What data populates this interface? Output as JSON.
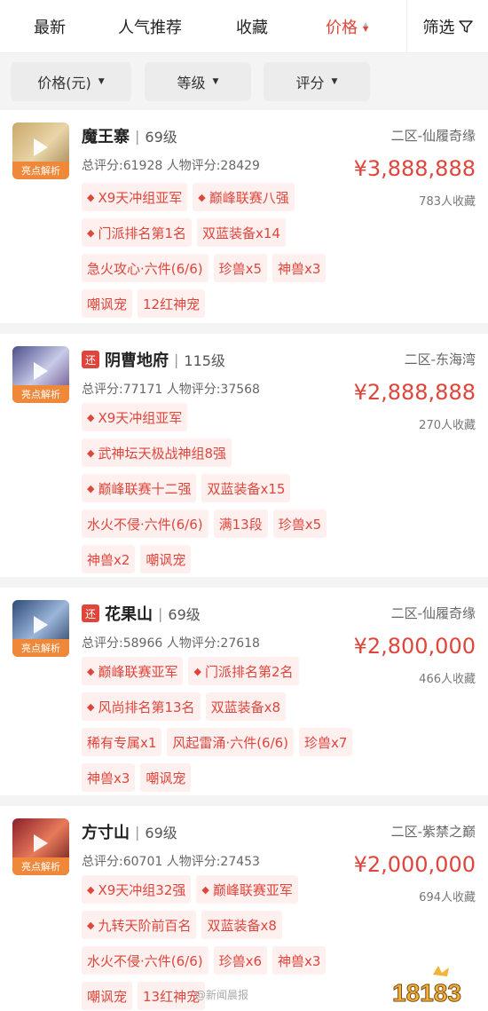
{
  "tabs": [
    {
      "label": "最新"
    },
    {
      "label": "人气推荐"
    },
    {
      "label": "收藏"
    },
    {
      "label": "价格"
    }
  ],
  "filter_label": "筛选",
  "filters": [
    {
      "label": "价格(元)"
    },
    {
      "label": "等级"
    },
    {
      "label": "评分"
    }
  ],
  "avatar_badge": "亮点解析",
  "items": [
    {
      "name": "魔王寨",
      "level": "69级",
      "huan": "",
      "server": "二区-仙履奇缘",
      "score": "总评分:61928 人物评分:28429",
      "price": "¥3,888,888",
      "favorites": "783人收藏",
      "tags": [
        {
          "text": "X9天冲组亚军",
          "diamond": true
        },
        {
          "text": "巅峰联赛八强",
          "diamond": true
        },
        {
          "text": "门派排名第1名",
          "diamond": true
        },
        {
          "text": "双蓝装备x14",
          "diamond": false
        },
        {
          "text": "急火攻心·六件(6/6)",
          "diamond": false
        },
        {
          "text": "珍兽x5",
          "diamond": false
        },
        {
          "text": "神兽x3",
          "diamond": false
        },
        {
          "text": "嘲讽宠",
          "diamond": false
        },
        {
          "text": "12红神宠",
          "diamond": false
        }
      ]
    },
    {
      "name": "阴曹地府",
      "level": "115级",
      "huan": "还",
      "server": "二区-东海湾",
      "score": "总评分:77171 人物评分:37568",
      "price": "¥2,888,888",
      "favorites": "270人收藏",
      "tags": [
        {
          "text": "X9天冲组亚军",
          "diamond": true
        },
        {
          "text": "武神坛天极战神组8强",
          "diamond": true
        },
        {
          "text": "巅峰联赛十二强",
          "diamond": true
        },
        {
          "text": "双蓝装备x15",
          "diamond": false
        },
        {
          "text": "水火不侵·六件(6/6)",
          "diamond": false
        },
        {
          "text": "满13段",
          "diamond": false
        },
        {
          "text": "珍兽x5",
          "diamond": false
        },
        {
          "text": "神兽x2",
          "diamond": false
        },
        {
          "text": "嘲讽宠",
          "diamond": false
        }
      ]
    },
    {
      "name": "花果山",
      "level": "69级",
      "huan": "还",
      "server": "二区-仙履奇缘",
      "score": "总评分:58966 人物评分:27618",
      "price": "¥2,800,000",
      "favorites": "466人收藏",
      "tags": [
        {
          "text": "巅峰联赛亚军",
          "diamond": true
        },
        {
          "text": "门派排名第2名",
          "diamond": true
        },
        {
          "text": "风尚排名第13名",
          "diamond": true
        },
        {
          "text": "双蓝装备x8",
          "diamond": false
        },
        {
          "text": "稀有专属x1",
          "diamond": false
        },
        {
          "text": "风起雷涌·六件(6/6)",
          "diamond": false
        },
        {
          "text": "珍兽x7",
          "diamond": false
        },
        {
          "text": "神兽x3",
          "diamond": false
        },
        {
          "text": "嘲讽宠",
          "diamond": false
        }
      ]
    },
    {
      "name": "方寸山",
      "level": "69级",
      "huan": "",
      "server": "二区-紫禁之巅",
      "score": "总评分:60701 人物评分:27453",
      "price": "¥2,000,000",
      "favorites": "694人收藏",
      "tags": [
        {
          "text": "X9天冲组32强",
          "diamond": true
        },
        {
          "text": "巅峰联赛亚军",
          "diamond": true
        },
        {
          "text": "九转天阶前百名",
          "diamond": true
        },
        {
          "text": "双蓝装备x8",
          "diamond": false
        },
        {
          "text": "水火不侵·六件(6/6)",
          "diamond": false
        },
        {
          "text": "珍兽x6",
          "diamond": false
        },
        {
          "text": "神兽x3",
          "diamond": false
        },
        {
          "text": "嘲讽宠",
          "diamond": false
        },
        {
          "text": "13红神宠",
          "diamond": false
        }
      ]
    }
  ],
  "watermark": "@新闻晨报",
  "logo_text": "18183",
  "colors": {
    "accent": "#e0453b",
    "badge": "#f0883a",
    "tag_bg": "#fdf0ef"
  }
}
